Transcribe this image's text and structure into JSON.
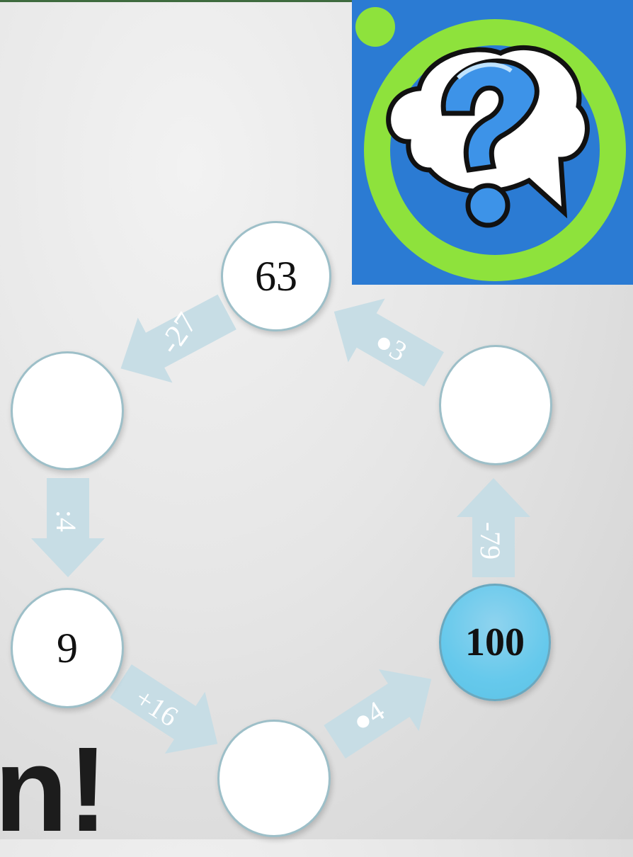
{
  "diagram": {
    "nodes": [
      {
        "id": "top",
        "value": "63"
      },
      {
        "id": "upper-left",
        "value": ""
      },
      {
        "id": "lower-left",
        "value": "9"
      },
      {
        "id": "bottom",
        "value": ""
      },
      {
        "id": "lower-right",
        "value": "100"
      },
      {
        "id": "upper-right",
        "value": ""
      }
    ],
    "operations": {
      "top_to_upper_left": "-27",
      "upper_left_to_lower_left": ":4",
      "lower_left_to_bottom": "+16",
      "bottom_to_lower_right": "●4",
      "lower_right_to_upper_right": "-79",
      "upper_right_to_top": "●3"
    },
    "start_node": "lower-right",
    "fragment_text": "n!"
  },
  "logo": {
    "name": "question-mark-speech-bubble",
    "colors": {
      "ring": "#8ee23c",
      "mark": "#3d93e8",
      "background": "#2f7ed0"
    }
  },
  "colors": {
    "arrow": "#c7dde5",
    "node_border": "#9dbfc8",
    "start_node": "#66c9ec"
  }
}
